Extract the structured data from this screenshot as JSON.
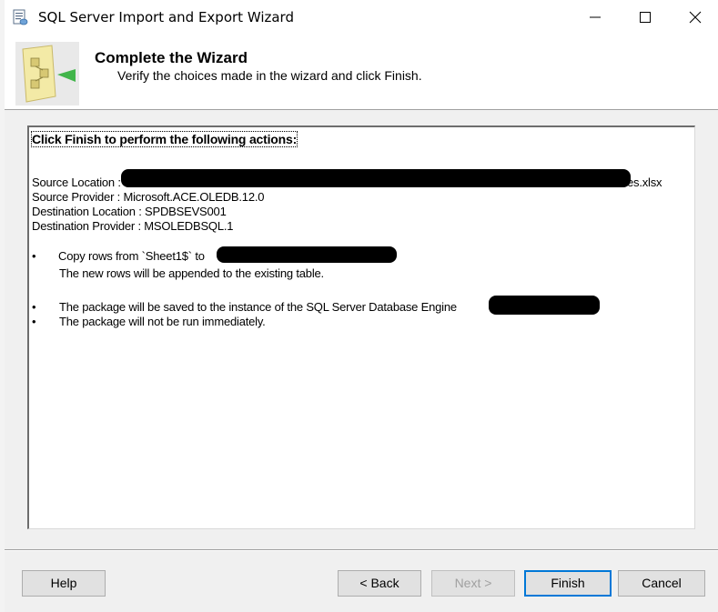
{
  "window": {
    "title": "SQL Server Import and Export Wizard"
  },
  "header": {
    "title": "Complete the Wizard",
    "subtitle": "Verify the choices made in the wizard and click Finish."
  },
  "summary": {
    "heading": "Click Finish to perform the following actions:",
    "source_location_label": "Source Location :",
    "source_location_suffix": "es.xlsx",
    "source_provider": "Source Provider : Microsoft.ACE.OLEDB.12.0",
    "destination_location": "Destination Location : SPDBSEVS001",
    "destination_provider": "Destination Provider : MSOLEDBSQL.1",
    "bullet_1": "Copy rows from `Sheet1$` to",
    "bullet_1_detail": "The new rows will be appended to the existing table.",
    "bullet_2": "The package will be saved to the instance of the SQL Server Database Engine",
    "bullet_3": "The package will not be run immediately.",
    "bullet_glyph": "•"
  },
  "buttons": {
    "help": "Help",
    "back": "< Back",
    "next": "Next >",
    "finish": "Finish",
    "cancel": "Cancel"
  }
}
